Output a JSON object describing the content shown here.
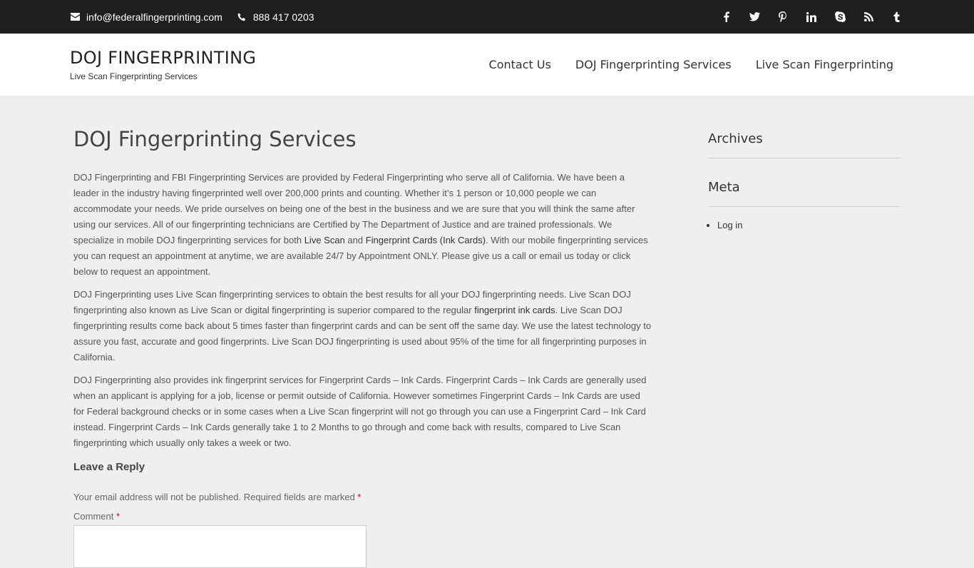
{
  "topbar": {
    "email": "info@federalfingerprinting.com",
    "phone": "888 417 0203",
    "social_icons": [
      "facebook-icon",
      "twitter-icon",
      "pinterest-icon",
      "linkedin-icon",
      "skype-icon",
      "rss-icon",
      "tumblr-icon"
    ]
  },
  "header": {
    "site_title": "DOJ FINGERPRINTING",
    "tagline": "Live Scan Fingerprinting Services",
    "nav": [
      "Contact Us",
      "DOJ Fingerprinting Services",
      "Live Scan Fingerprinting"
    ]
  },
  "main": {
    "page_title": "DOJ Fingerprinting Services",
    "p1_a": "DOJ Fingerprinting and FBI Fingerprinting Services are provided by Federal Fingerprinting who serve all of California. We have been a leader in the industry having fingerprinted well over 200,000 prints and counting. Whether it’s 1 person or 10,000 people we can accommodate your needs. We pride ourselves on being one of the best in the business and we are sure that you will think the same after using our services. All of our fingerprinting technicians are Certified by The Department of Justice and are trained professionals. We specialize in mobile DOJ fingerprinting services for both ",
    "p1_link1": "Live Scan",
    "p1_b": " and ",
    "p1_link2": "Fingerprint Cards (Ink Cards)",
    "p1_c": ". With our mobile fingerprinting services you can request an appointment at anytime, we are available 24/7 by Appointment ONLY. Please give us a call or email us today or click below to request an appointment.",
    "p2_a": "DOJ Fingerprinting uses Live Scan fingerprinting services to obtain the best results for all your DOJ fingerprinting needs. Live Scan DOJ fingerprinting also known as Live Scan or digital fingerprinting is superior compared to the regular ",
    "p2_link": "fingerprint ink cards",
    "p2_b": ". Live Scan DOJ fingerprinting results come back about 5 times faster than fingerprint cards and can be sent off the same day. We use the latest technology to assure you fast, accurate and good fingerprints. Live Scan DOJ fingerprinting is used about 95% of the time for all fingerprinting purposes in California.",
    "p3": "DOJ Fingerprinting also provides ink fingerprint services for Fingerprint Cards – Ink Cards. Fingerprint Cards – Ink Cards are generally used when an applicant is applying for a job, license or permit outside of California. However sometimes Fingerprint Cards – Ink Cards are used for Federal background checks or in some cases when a Live Scan fingerprint will not go through you can use a Fingerprint Card – Ink Card instead. Fingerprint Cards – Ink Cards generally take 1 to 2 Months to go through and come back with results, compared to Live Scan fingerprinting which usually only takes a week or two.",
    "reply_title": "Leave a Reply",
    "notes": "Your email address will not be published. Required fields are marked",
    "required_mark": "*",
    "comment_label": "Comment"
  },
  "sidebar": {
    "archives_title": "Archives",
    "meta_title": "Meta",
    "meta_items": [
      "Log in"
    ]
  }
}
